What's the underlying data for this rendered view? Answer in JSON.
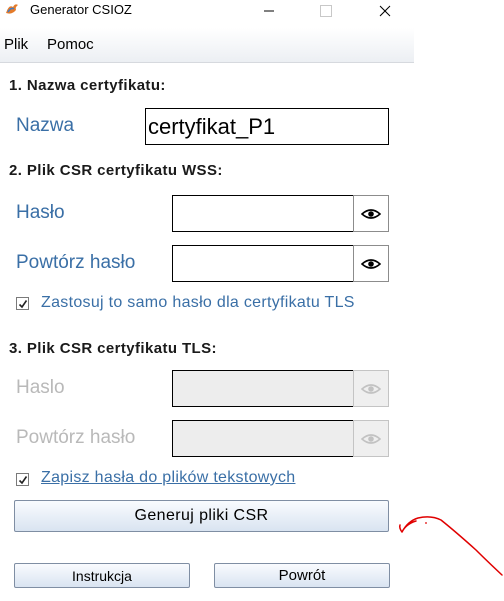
{
  "window": {
    "title": "Generator CSIOZ"
  },
  "menu": {
    "items": [
      {
        "label": "Plik"
      },
      {
        "label": "Pomoc"
      }
    ]
  },
  "section1": {
    "heading": "1. Nazwa certyfikatu:",
    "name_label": "Nazwa",
    "name_value": "certyfikat_P1"
  },
  "section2": {
    "heading": "2. Plik CSR certyfikatu WSS:",
    "password_label": "Hasło",
    "password_value": "",
    "repeat_label": "Powtórz hasło",
    "repeat_value": "",
    "same_password_checkbox": {
      "label": "Zastosuj to samo hasło dla certyfikatu TLS",
      "checked": true
    }
  },
  "section3": {
    "heading": "3. Plik CSR certyfikatu TLS:",
    "password_label": "Haslo",
    "password_value": "",
    "repeat_label": "Powtórz hasło",
    "repeat_value": "",
    "save_passwords_checkbox": {
      "label": "Zapisz hasła do plików tekstowych",
      "checked": true
    }
  },
  "buttons": {
    "generate": "Generuj pliki CSR",
    "instructions": "Instrukcja",
    "back": "Powrót"
  },
  "colors": {
    "label_blue": "#3a6fa6",
    "annotation_red": "#e00000"
  }
}
